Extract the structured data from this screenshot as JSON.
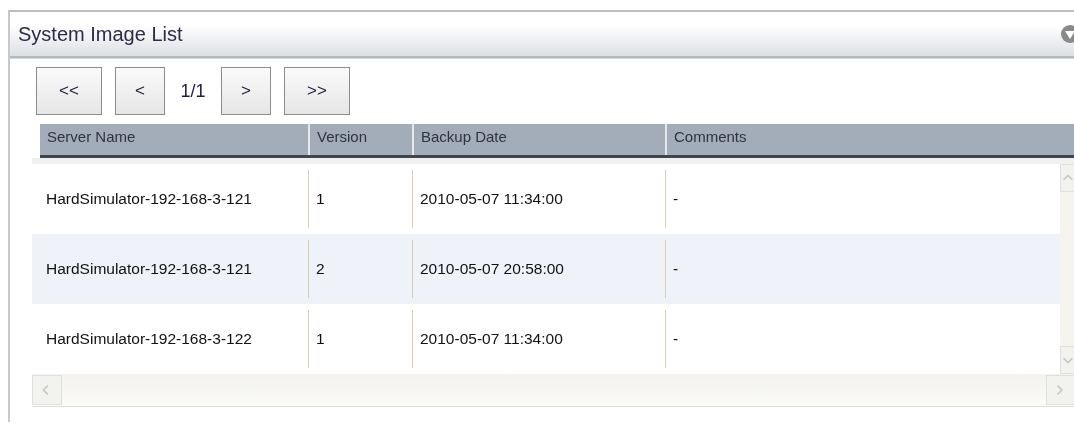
{
  "panel": {
    "title": "System Image List"
  },
  "pager": {
    "first": "<<",
    "prev": "<",
    "page": "1/1",
    "next": ">",
    "last": ">>"
  },
  "table": {
    "columns": [
      "Server Name",
      "Version",
      "Backup Date",
      "Comments"
    ],
    "rows": [
      {
        "cells": [
          "HardSimulator-192-168-3-121",
          "1",
          "2010-05-07 11:34:00",
          "-"
        ]
      },
      {
        "cells": [
          "HardSimulator-192-168-3-121",
          "2",
          "2010-05-07 20:58:00",
          "-"
        ]
      },
      {
        "cells": [
          "HardSimulator-192-168-3-122",
          "1",
          "2010-05-07 11:34:00",
          "-"
        ]
      }
    ]
  }
}
